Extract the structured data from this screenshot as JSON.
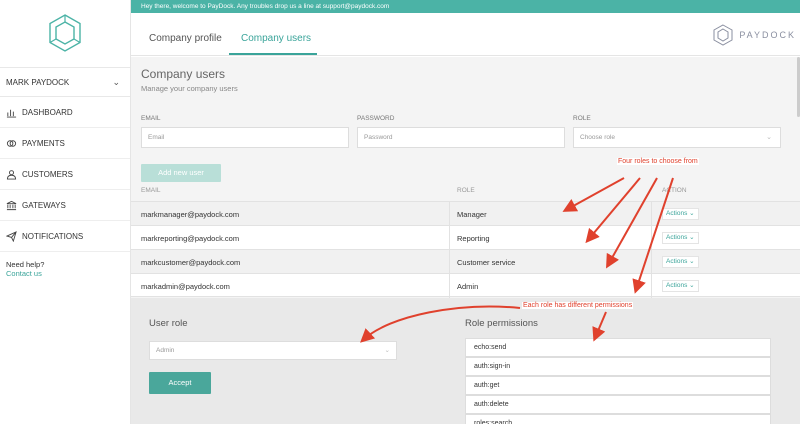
{
  "banner": {
    "text": "Hey there, welcome to PayDock. Any troubles drop us a line at support@paydock.com"
  },
  "sidebar": {
    "user_name": "MARK PAYDOCK",
    "items": [
      {
        "label": "DASHBOARD",
        "icon": "bar-chart-icon"
      },
      {
        "label": "PAYMENTS",
        "icon": "coins-icon"
      },
      {
        "label": "CUSTOMERS",
        "icon": "users-icon"
      },
      {
        "label": "GATEWAYS",
        "icon": "bank-icon"
      },
      {
        "label": "NOTIFICATIONS",
        "icon": "paper-plane-icon"
      }
    ],
    "help_text": "Need help?",
    "contact_link": "Contact us"
  },
  "tabs": [
    {
      "label": "Company profile",
      "active": false
    },
    {
      "label": "Company users",
      "active": true
    }
  ],
  "brand": {
    "name": "PAYDOCK"
  },
  "page": {
    "title": "Company users",
    "subtitle": "Manage your company users"
  },
  "form": {
    "email_label": "EMAIL",
    "email_placeholder": "Email",
    "password_label": "PASSWORD",
    "password_placeholder": "Password",
    "role_label": "ROLE",
    "role_placeholder": "Choose role",
    "add_button": "Add new user"
  },
  "table": {
    "headers": {
      "email": "EMAIL",
      "role": "ROLE",
      "actions": "ACTION"
    },
    "rows": [
      {
        "email": "markmanager@paydock.com",
        "role": "Manager",
        "actions": "Actions"
      },
      {
        "email": "markreporting@paydock.com",
        "role": "Reporting",
        "actions": "Actions"
      },
      {
        "email": "markcustomer@paydock.com",
        "role": "Customer service",
        "actions": "Actions"
      },
      {
        "email": "markadmin@paydock.com",
        "role": "Admin",
        "actions": "Actions"
      }
    ]
  },
  "panel": {
    "user_role_title": "User role",
    "selected_role": "Admin",
    "accept_button": "Accept",
    "permissions_title": "Role permissions",
    "permissions": [
      "echo:send",
      "auth:sign-in",
      "auth:get",
      "auth:delete",
      "roles:search"
    ]
  },
  "annotations": {
    "four_roles": "Four roles to choose from",
    "permissions_note": "Each role has different permissions"
  },
  "colors": {
    "accent": "#4bb3a6",
    "annotation": "#e0412d"
  }
}
